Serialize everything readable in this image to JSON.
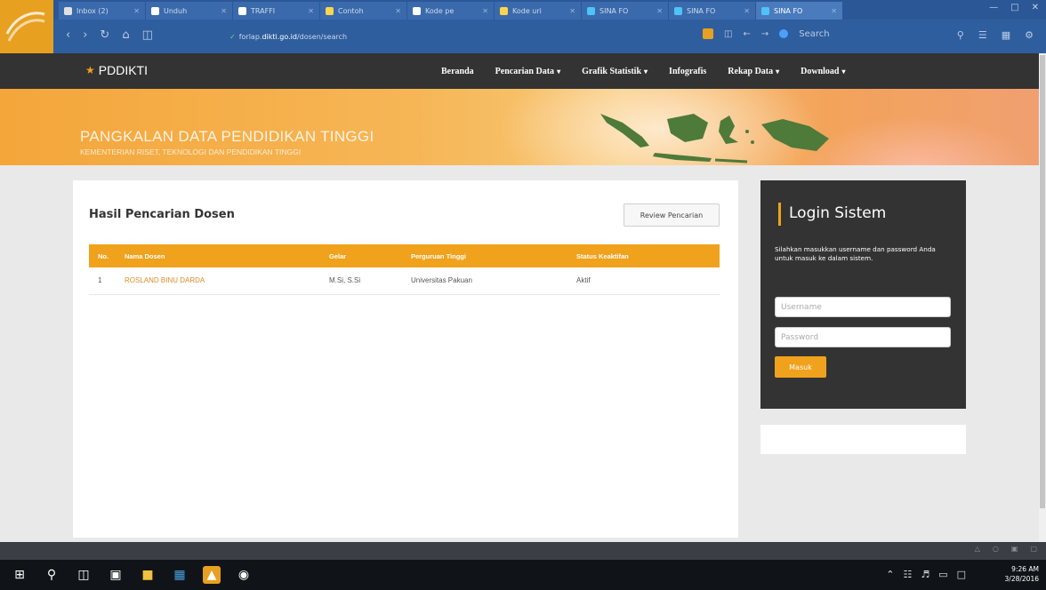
{
  "browser": {
    "tabs": [
      {
        "label": "Inbox (2)",
        "color": "#e0e0e0"
      },
      {
        "label": "Unduh",
        "color": "#ffffff"
      },
      {
        "label": "TRAFFI",
        "color": "#ffffff"
      },
      {
        "label": "Contoh",
        "color": "#ffd54f"
      },
      {
        "label": "Kode pe",
        "color": "#ffffff"
      },
      {
        "label": "Kode uri",
        "color": "#ffd54f"
      },
      {
        "label": "SINA FO",
        "color": "#4fc3f7"
      },
      {
        "label": "SINA FO",
        "color": "#4fc3f7"
      },
      {
        "label": "SINA FO",
        "color": "#4fc3f7"
      }
    ],
    "url_prefix": "forlap.",
    "url_domain": "dikti.go.id",
    "url_path": "/dosen/search",
    "search_placeholder": "Search"
  },
  "site": {
    "brand": "PDDIKTI",
    "menu": [
      {
        "label": "Beranda",
        "dropdown": false
      },
      {
        "label": "Pencarian Data",
        "dropdown": true
      },
      {
        "label": "Grafik Statistik",
        "dropdown": true
      },
      {
        "label": "Infografis",
        "dropdown": false
      },
      {
        "label": "Rekap Data",
        "dropdown": true
      },
      {
        "label": "Download",
        "dropdown": true
      }
    ],
    "banner_title": "PANGKALAN DATA PENDIDIKAN TINGGI",
    "banner_subtitle": "KEMENTERIAN RISET, TEKNOLOGI DAN PENDIDIKAN TINGGI"
  },
  "results": {
    "title": "Hasil Pencarian Dosen",
    "review_button": "Review Pencarian",
    "columns": [
      "No.",
      "Nama Dosen",
      "Gelar",
      "Perguruan Tinggi",
      "Status Keaktifan"
    ],
    "rows": [
      {
        "no": "1",
        "nama": "ROSLAND BINU DARDA",
        "gelar": "M.Si, S.Si",
        "pt": "Universitas Pakuan",
        "status": "Aktif"
      }
    ]
  },
  "login": {
    "title": "Login Sistem",
    "description": "Silahkan masukkan username dan password Anda untuk masuk ke dalam sistem.",
    "username_placeholder": "Username",
    "password_placeholder": "Password",
    "submit": "Masuk"
  },
  "taskbar": {
    "time": "9:26 AM",
    "date": "3/28/2016"
  }
}
